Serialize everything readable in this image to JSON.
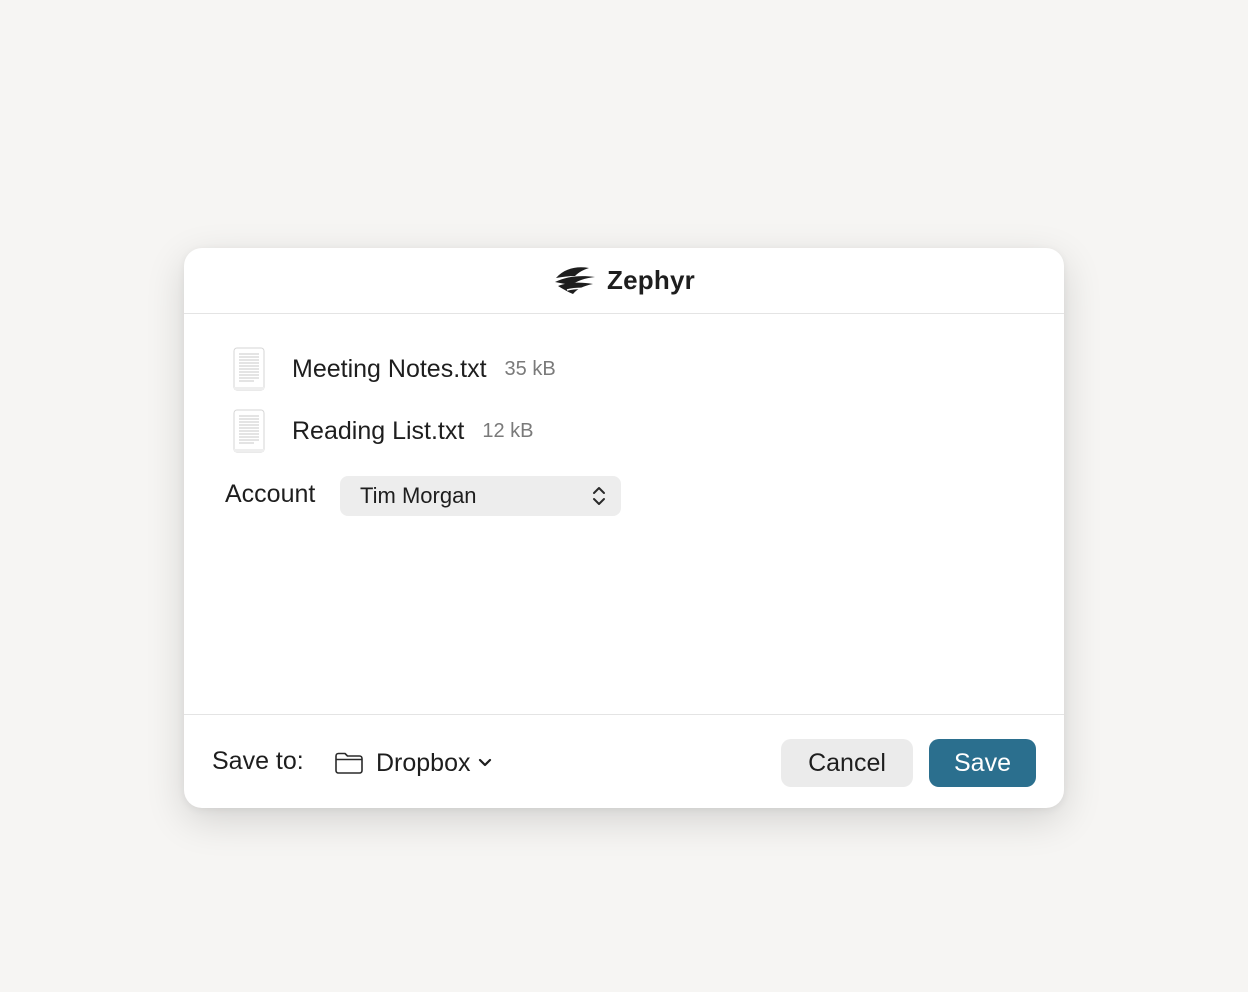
{
  "dialog": {
    "app_name": "Zephyr",
    "brand_icon": "zephyr-wind-logo",
    "files": [
      {
        "name": "Meeting Notes.txt",
        "size": "35 kB",
        "icon": "text-document-icon"
      },
      {
        "name": "Reading List.txt",
        "size": "12 kB",
        "icon": "text-document-icon"
      }
    ],
    "account": {
      "label": "Account",
      "selected": "Tim Morgan",
      "icon": "up-down-chevron-icon"
    },
    "footer": {
      "save_to_label": "Save to:",
      "location": "Dropbox",
      "location_icon": "folder-icon",
      "cancel_label": "Cancel",
      "save_label": "Save"
    }
  },
  "colors": {
    "background": "#f6f5f3",
    "dialog": "#ffffff",
    "primary_button": "#2b6f8e",
    "secondary_button": "#ebebeb"
  }
}
